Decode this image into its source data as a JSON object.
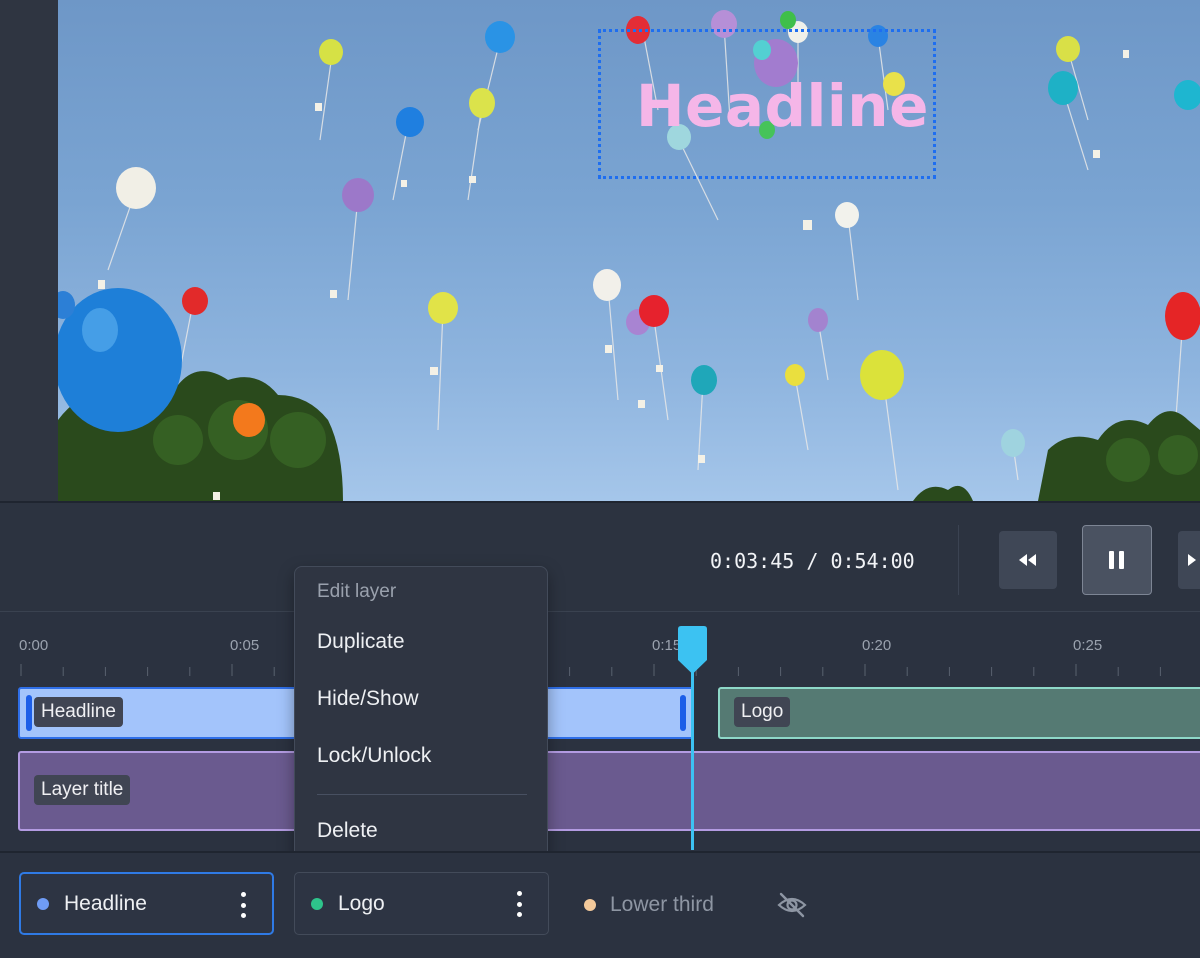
{
  "preview": {
    "headline_text": "Headline"
  },
  "transport": {
    "current_time": "0:03:45",
    "separator": "/",
    "total_time": "0:54:00",
    "rewind_icon": "rewind-icon",
    "pause_icon": "pause-icon",
    "forward_icon": "forward-icon"
  },
  "timeline": {
    "ruler_labels": [
      "0:00",
      "0:05",
      "0:15",
      "0:20",
      "0:25"
    ],
    "tracks": {
      "headline": "Headline",
      "logo": "Logo",
      "layer_title": "Layer title"
    },
    "colors": {
      "headline": "#a3c4fb",
      "logo": "#557a73",
      "layer_title": "#6a5a8f",
      "playhead": "#3cc2f2"
    }
  },
  "context_menu": {
    "title": "Edit layer",
    "items": [
      "Duplicate",
      "Hide/Show",
      "Lock/Unlock",
      "Delete"
    ]
  },
  "layers": {
    "items": [
      {
        "label": "Headline",
        "color": "#6f9cf5",
        "selected": true
      },
      {
        "label": "Logo",
        "color": "#2ec48b",
        "selected": false
      },
      {
        "label": "Lower third",
        "color": "#f3c99b",
        "selected": false,
        "hidden": true
      }
    ],
    "visibility_icon": "eye-off-icon"
  }
}
